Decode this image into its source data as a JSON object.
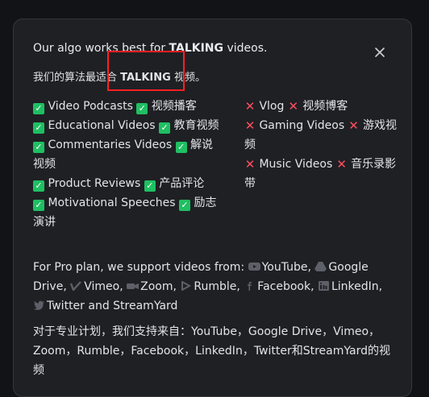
{
  "dialog": {
    "title_prefix": "Our algo works best for ",
    "title_emphasis": "TALKING",
    "title_suffix": " videos.",
    "subtitle_prefix": "我们的算法最适合 ",
    "subtitle_emphasis": "TALKING",
    "subtitle_suffix": " 视频。",
    "good_items": [
      {
        "en": "Video Podcasts",
        "zh": "视频播客"
      },
      {
        "en": "Educational Videos",
        "zh": "教育视频"
      },
      {
        "en": "Commentaries Videos",
        "zh": "解说视频"
      },
      {
        "en": "Product Reviews",
        "zh": "产品评论"
      },
      {
        "en": "Motivational Speeches",
        "zh": "励志演讲"
      }
    ],
    "bad_items": [
      {
        "en": "Vlog",
        "zh": "视频博客"
      },
      {
        "en": "Gaming Videos",
        "zh": "游戏视频"
      },
      {
        "en": "Music Videos",
        "zh": "音乐录影带"
      }
    ],
    "pro_plan_text": "For Pro plan, we support videos from:",
    "sources": [
      "YouTube,",
      "Google Drive,",
      "Vimeo,",
      "Zoom,",
      "Rumble,",
      "Facebook,",
      "LinkedIn,"
    ],
    "source_last": "Twitter and StreamYard",
    "cn_paragraph": "对于专业计划，我们支持来自：YouTube，Google Drive，Vimeo，Zoom，Rumble，Facebook，LinkedIn，Twitter和StreamYard的视频",
    "colors": {
      "good": "#1fbf62",
      "bad": "#ff4d5e",
      "highlight": "#ff1f1f"
    }
  }
}
